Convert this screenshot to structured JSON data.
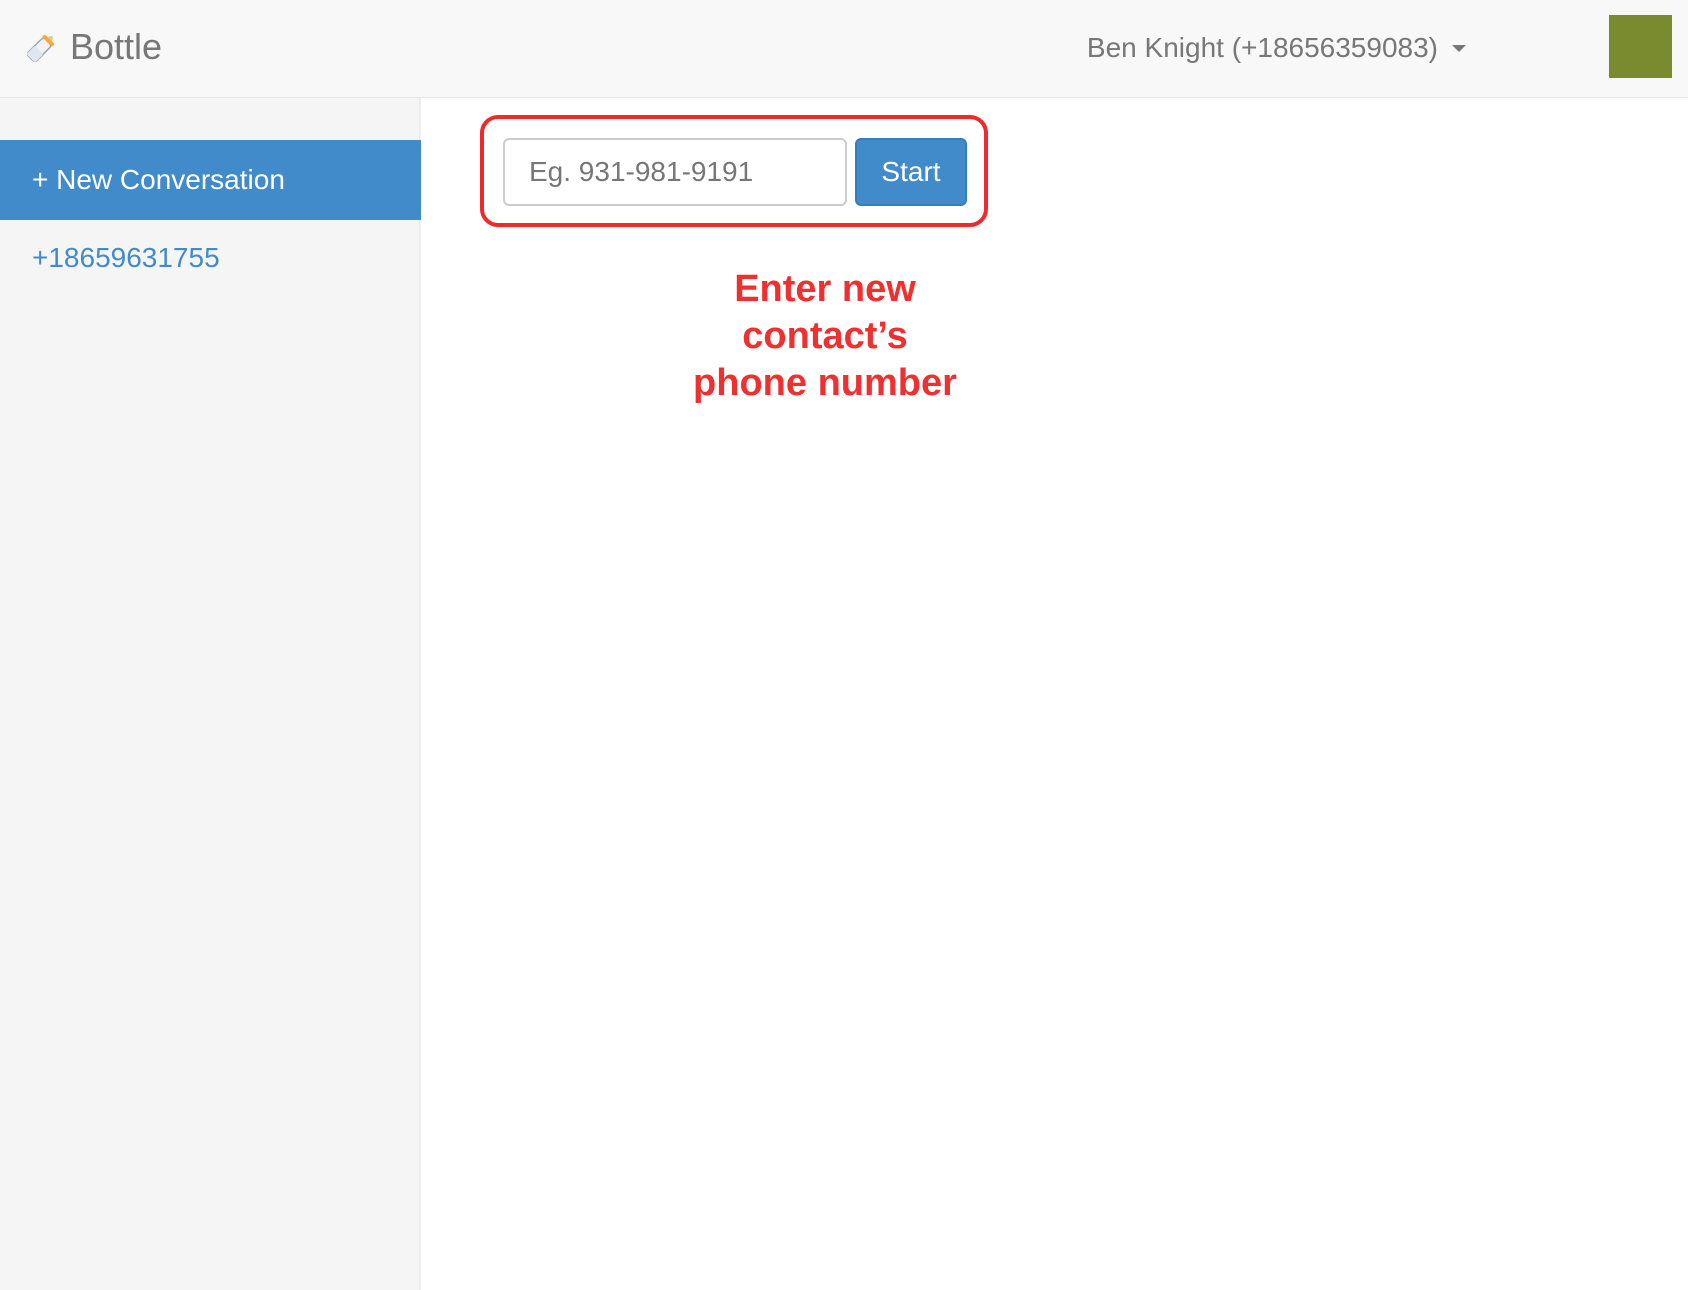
{
  "navbar": {
    "brand_label": "Bottle",
    "brand_icon": "baby-bottle-icon",
    "user_label": "Ben Knight (+18656359083)",
    "avatar_color": "#7a8a2e"
  },
  "sidebar": {
    "new_conversation_label": "+ New Conversation",
    "contacts": [
      "+18659631755"
    ]
  },
  "main": {
    "phone_input": {
      "placeholder": "Eg. 931-981-9191",
      "value": ""
    },
    "start_label": "Start",
    "annotation": {
      "line1": "Enter new",
      "line2": "contact’s",
      "line3": "phone number",
      "color": "#ee3030"
    }
  },
  "colors": {
    "primary": "#428bca",
    "annotation_red": "#ee2a2a"
  }
}
